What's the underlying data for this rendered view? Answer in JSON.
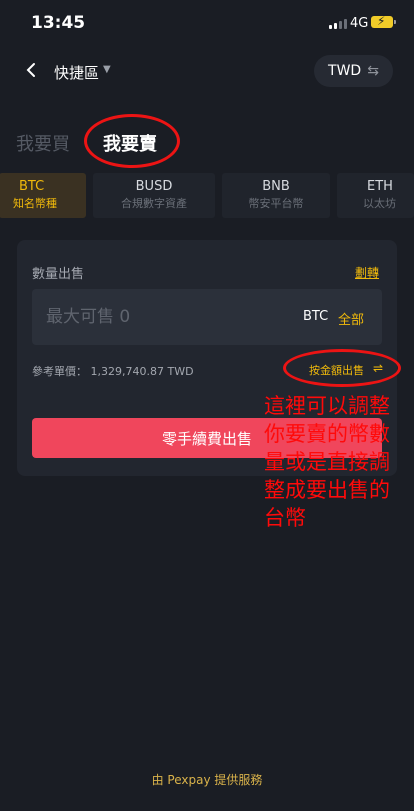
{
  "status_bar": {
    "time": "13:45",
    "network": "4G"
  },
  "header": {
    "title": "快捷區",
    "currency": "TWD"
  },
  "tabs": {
    "buy": "我要買",
    "sell": "我要賣"
  },
  "coins": [
    {
      "name": "BTC",
      "sub": "知名幣種",
      "active": true
    },
    {
      "name": "BUSD",
      "sub": "合規數字資產",
      "active": false
    },
    {
      "name": "BNB",
      "sub": "幣安平台幣",
      "active": false
    },
    {
      "name": "ETH",
      "sub": "以太坊",
      "active": false
    }
  ],
  "form": {
    "quantity_label": "數量出售",
    "transfer_link": "劃轉",
    "amount_placeholder": "最大可售 0",
    "unit": "BTC",
    "all_label": "全部",
    "reference_price": "參考單價： 1,329,740.87 TWD",
    "by_amount_label": "按金額出售",
    "submit_label": "零手續費出售"
  },
  "annotation": "這裡可以調整你要賣的幣數量或是直接調整成要出售的台幣",
  "footer": "由 Pexpay 提供服務",
  "colors": {
    "accent": "#f0b90b",
    "sell_button": "#f0465c",
    "annotation": "#ec1414",
    "background": "#1a1d24"
  }
}
